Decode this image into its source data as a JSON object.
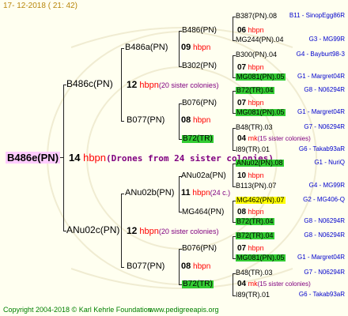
{
  "header": {
    "date": "17-  12-2018  ( 21:  42)"
  },
  "footer": {
    "copyright": "Copyright 2004-2018 © Karl Kehrle Foundation",
    "website": "www.pedigreeapis.org"
  },
  "root": {
    "name": "B486e(PN)",
    "num": "14",
    "hb": "hbpn",
    "note": "(Drones from 24 sister colonies)"
  },
  "gen1": {
    "top": {
      "name": "B486c(PN)",
      "num": "12",
      "hb": "hbpn",
      "note": "(20 sister colonies)"
    },
    "bottom": {
      "name": "ANu02c(PN)",
      "num": "12",
      "hb": "hbpn",
      "note": "(20 sister colonies)"
    }
  },
  "gen2": {
    "a": {
      "name": "B486a(PN)",
      "num": "09",
      "hb": "hbpn"
    },
    "b": {
      "name": "B077(PN)",
      "num": "08",
      "hb": "hbpn"
    },
    "c": {
      "name": "ANu02b(PN)",
      "num": "11",
      "hb": "hbpn",
      "note": "(24 c.)"
    },
    "d": {
      "name": "B077(PN)",
      "num": "08",
      "hb": "hbpn"
    }
  },
  "gen3": {
    "a1": {
      "name": "B486(PN)",
      "num": "06",
      "hb": "hbpn"
    },
    "a2": {
      "name": "B302(PN)",
      "num": "07",
      "hb": "hbpn"
    },
    "b1": {
      "name": "B076(PN)",
      "num": "07",
      "hb": "hbpn"
    },
    "b2": {
      "name": "B72(TR)"
    },
    "c1": {
      "name": "ANu02a(PN)",
      "num": "10",
      "hb": "hbpn"
    },
    "c2": {
      "name": "MG464(PN)",
      "num": "08",
      "hb": "hbpn"
    },
    "d1": {
      "name": "B076(PN)",
      "num": "07",
      "hb": "hbpn"
    },
    "d2": {
      "name": "B72(TR)"
    }
  },
  "gen4": [
    {
      "name": "B387(PN).08",
      "id": "B11 - SinopEgg86R",
      "hl": ""
    },
    {
      "name": "MG244(PN).04",
      "id": "G3 - MG99R",
      "hl": ""
    },
    {
      "name": "B300(PN).04",
      "id": "G4 - Bayburt98-3",
      "hl": ""
    },
    {
      "name": "MG081(PN).05",
      "id": "G1 - Margret04R",
      "hl": "green"
    },
    {
      "name": "B72(TR).04",
      "id": "G8 - N06294R",
      "hl": "green"
    },
    {
      "name": "MG081(PN).05",
      "id": "G1 - Margret04R",
      "hl": "green"
    },
    {
      "name": "B48(TR).03",
      "id": "G7 - N06294R",
      "hl": ""
    },
    {
      "name": "I89(TR).01",
      "id": "G6 - Takab93aR",
      "hl": ""
    },
    {
      "name": "ANu02(PN).08",
      "id": "G1 - NuriQ",
      "hl": "green"
    },
    {
      "name": "B113(PN).07",
      "id": "G4 - MG99R",
      "hl": ""
    },
    {
      "name": "MG462(PN).07",
      "id": "G2 - MG406-Q",
      "hl": "yellow"
    },
    {
      "name": "B72(TR).04",
      "id": "G8 - N06294R",
      "hl": "green"
    },
    {
      "name": "B72(TR).04",
      "id": "G8 - N06294R",
      "hl": "green"
    },
    {
      "name": "MG081(PN).05",
      "id": "G1 - Margret04R",
      "hl": "green"
    },
    {
      "name": "B48(TR).03",
      "id": "G7 - N06294R",
      "hl": ""
    },
    {
      "name": "I89(TR).01",
      "id": "G6 - Takab93aR",
      "hl": ""
    }
  ],
  "b72a": {
    "num": "04",
    "mk": "mk",
    "note": "(15 sister colonies)"
  },
  "b72b": {
    "num": "04",
    "mk": "mk",
    "note": "(15 sister colonies)"
  },
  "colors": {
    "background": "#fffff0",
    "green": "#33cc33",
    "yellow": "#ffff00",
    "pink": "#ffccff",
    "red": "#ff0000",
    "blue": "#0000cc",
    "purple": "#800080"
  }
}
